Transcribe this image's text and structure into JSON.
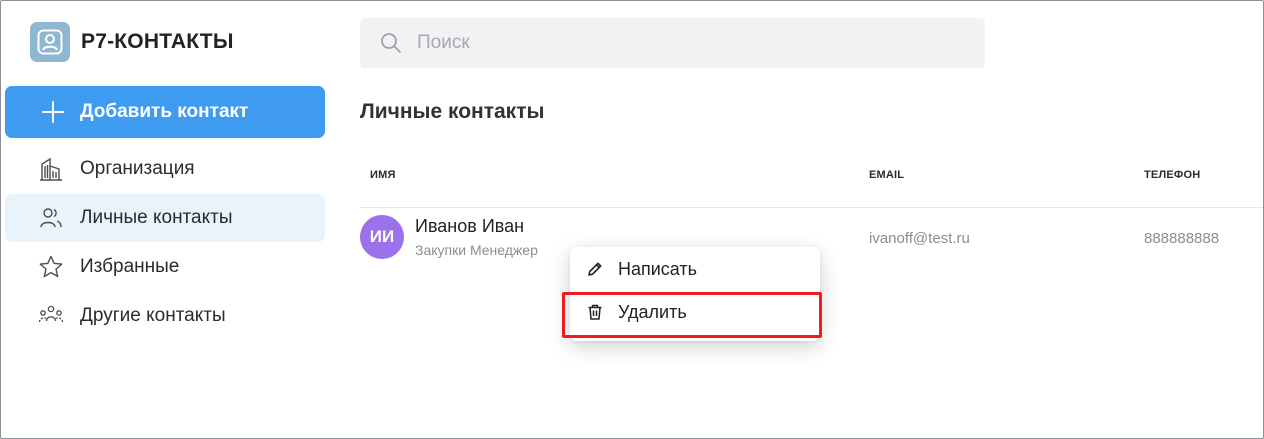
{
  "app": {
    "title": "Р7-КОНТАКТЫ",
    "logo_icon": "user-card-icon"
  },
  "sidebar": {
    "add_button": {
      "label": "Добавить контакт",
      "icon": "plus-icon"
    },
    "items": [
      {
        "label": "Организация",
        "icon": "building-icon",
        "active": false
      },
      {
        "label": "Личные контакты",
        "icon": "users-icon",
        "active": true
      },
      {
        "label": "Избранные",
        "icon": "star-icon",
        "active": false
      },
      {
        "label": "Другие контакты",
        "icon": "people-group-icon",
        "active": false
      }
    ]
  },
  "search": {
    "placeholder": "Поиск",
    "value": ""
  },
  "main": {
    "title": "Личные контакты",
    "columns": {
      "name": "ИМЯ",
      "email": "EMAIL",
      "phone": "ТЕЛЕФОН"
    },
    "rows": [
      {
        "initials": "ИИ",
        "name": "Иванов Иван",
        "subtitle": "Закупки Менеджер",
        "email": "ivanoff@test.ru",
        "phone": "888888888"
      }
    ]
  },
  "context_menu": {
    "items": [
      {
        "label": "Написать",
        "icon": "pencil-icon"
      },
      {
        "label": "Удалить",
        "icon": "trash-icon",
        "highlighted": true
      }
    ]
  },
  "colors": {
    "accent": "#3f9bf0",
    "active_bg": "#e8f3fc",
    "avatar": "#9b71ec",
    "highlight": "#ee1c1c"
  }
}
